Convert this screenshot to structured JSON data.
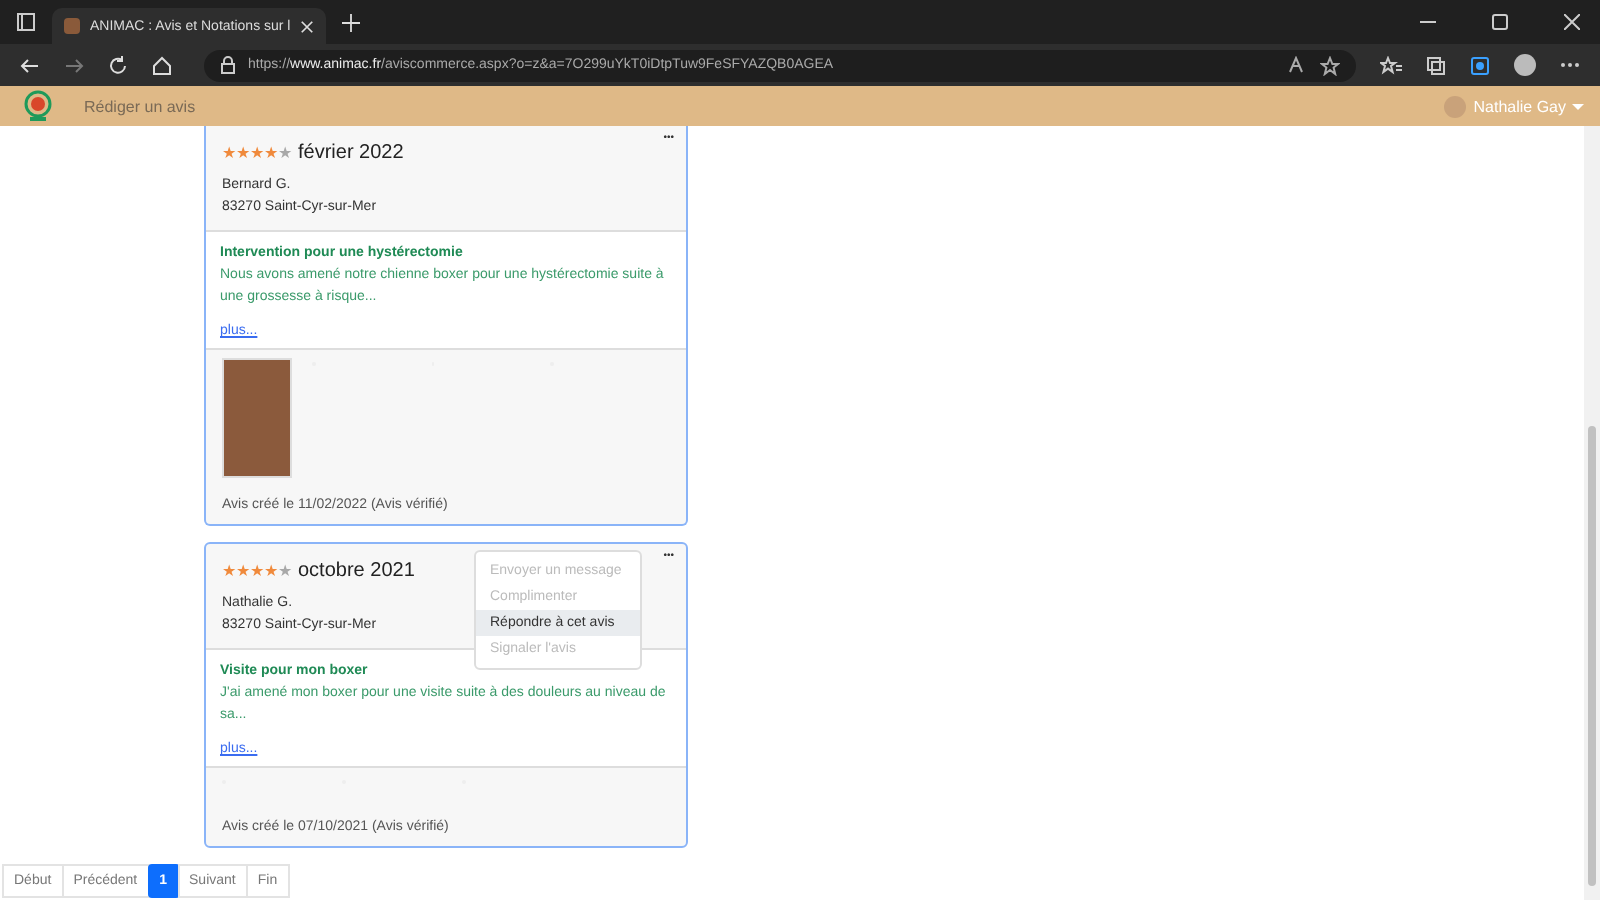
{
  "browser": {
    "tab_title": "ANIMAC : Avis et Notations sur l",
    "url_prefix": "https://",
    "url_domain": "www.animac.fr",
    "url_path": "/aviscommerce.aspx?o=z&a=7O299uYkT0iDtpTuw9FeSFYAZQB0AGEA"
  },
  "nav": {
    "link": "Rédiger un avis",
    "user": "Nathalie Gay"
  },
  "reviews": [
    {
      "stars": 4,
      "date": "février 2022",
      "author": "Bernard G.",
      "city": "83270 Saint-Cyr-sur-Mer",
      "title": "Intervention pour une hystérectomie",
      "text": "Nous avons amené notre chienne boxer pour une hystérectomie suite à une grossesse à risque...",
      "more": "plus...",
      "has_photo": true,
      "footer": "Avis créé le 11/02/2022  (Avis vérifié)",
      "options": "•••"
    },
    {
      "stars": 4,
      "date": "octobre 2021",
      "author": "Nathalie G.",
      "city": "83270 Saint-Cyr-sur-Mer",
      "title": "Visite pour mon boxer",
      "text": "J'ai amené mon boxer pour une visite suite à des douleurs au niveau de sa...",
      "more": "plus...",
      "has_photo": false,
      "footer": "Avis créé le 07/10/2021  (Avis vérifié)",
      "options": "•••",
      "menu": [
        {
          "label": "Envoyer un message",
          "disabled": true,
          "selected": false
        },
        {
          "label": "Complimenter",
          "disabled": true,
          "selected": false
        },
        {
          "label": "Répondre à cet avis",
          "disabled": false,
          "selected": true
        },
        {
          "label": "Signaler l'avis",
          "disabled": true,
          "selected": false
        }
      ]
    }
  ],
  "pagination": [
    {
      "label": "Début",
      "selected": false
    },
    {
      "label": "Précédent",
      "selected": false
    },
    {
      "label": "1",
      "selected": true
    },
    {
      "label": "Suivant",
      "selected": false
    },
    {
      "label": "Fin",
      "selected": false
    }
  ]
}
